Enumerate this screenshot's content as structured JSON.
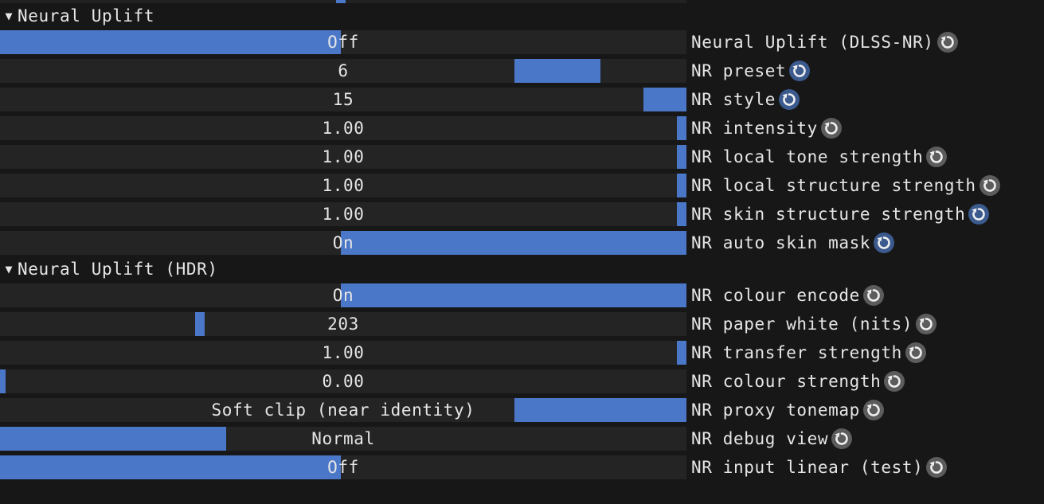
{
  "accent_color": "#4a77c8",
  "sections": [
    {
      "title": "Neural Uplift",
      "rows": [
        {
          "kind": "toggle",
          "value": "Off",
          "label": "Neural Uplift (DLSS-NR)",
          "reset": "grey",
          "fill_left": 0.0,
          "fill_right": 0.497
        },
        {
          "kind": "slider",
          "value": "6",
          "label": "NR preset",
          "reset": "blue",
          "fill_left": 0.749,
          "fill_right": 0.874
        },
        {
          "kind": "slider",
          "value": "15",
          "label": "NR style",
          "reset": "blue",
          "fill_left": 0.937,
          "fill_right": 1.0
        },
        {
          "kind": "slider",
          "value": "1.00",
          "label": "NR intensity",
          "reset": "grey",
          "fill_left": 0.986,
          "fill_right": 1.0
        },
        {
          "kind": "slider",
          "value": "1.00",
          "label": "NR local tone strength",
          "reset": "grey",
          "fill_left": 0.986,
          "fill_right": 1.0
        },
        {
          "kind": "slider",
          "value": "1.00",
          "label": "NR local structure strength",
          "reset": "grey",
          "fill_left": 0.986,
          "fill_right": 1.0
        },
        {
          "kind": "slider",
          "value": "1.00",
          "label": "NR skin structure strength",
          "reset": "blue",
          "fill_left": 0.986,
          "fill_right": 1.0
        },
        {
          "kind": "toggle",
          "value": "On",
          "label": "NR auto skin mask",
          "reset": "blue",
          "fill_left": 0.497,
          "fill_right": 1.0
        }
      ]
    },
    {
      "title": "Neural Uplift (HDR)",
      "rows": [
        {
          "kind": "toggle",
          "value": "On",
          "label": "NR colour encode",
          "reset": "grey",
          "fill_left": 0.497,
          "fill_right": 1.0
        },
        {
          "kind": "slider",
          "value": "203",
          "label": "NR paper white (nits)",
          "reset": "grey",
          "fill_left": 0.284,
          "fill_right": 0.298
        },
        {
          "kind": "slider",
          "value": "1.00",
          "label": "NR transfer strength",
          "reset": "grey",
          "fill_left": 0.986,
          "fill_right": 1.0
        },
        {
          "kind": "slider",
          "value": "0.00",
          "label": "NR colour strength",
          "reset": "grey",
          "fill_left": 0.0,
          "fill_right": 0.008
        },
        {
          "kind": "combo",
          "value": "Soft clip (near identity)",
          "label": "NR proxy tonemap",
          "reset": "grey",
          "fill_left": 0.749,
          "fill_right": 1.0
        },
        {
          "kind": "combo",
          "value": "Normal",
          "label": "NR debug view",
          "reset": "grey",
          "fill_left": 0.0,
          "fill_right": 0.329
        },
        {
          "kind": "toggle",
          "value": "Off",
          "label": "NR input linear (test)",
          "reset": "grey",
          "fill_left": 0.0,
          "fill_right": 0.497
        }
      ]
    }
  ]
}
